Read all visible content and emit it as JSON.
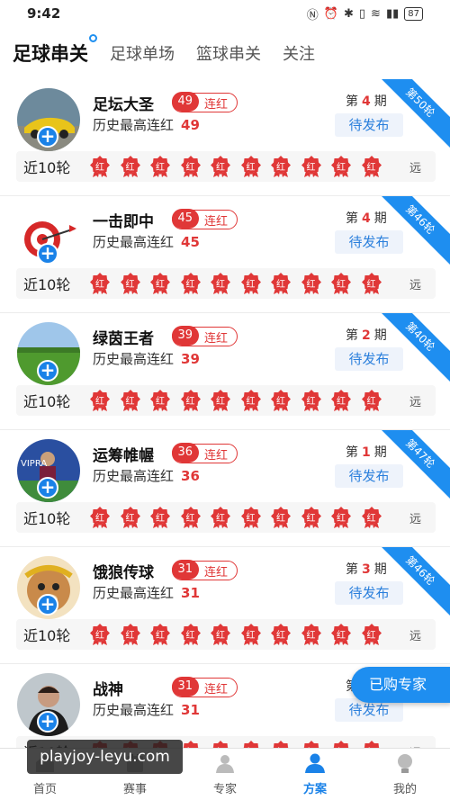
{
  "status_bar": {
    "time": "9:42",
    "battery": "87"
  },
  "tabs": [
    {
      "label": "足球串关",
      "active": true
    },
    {
      "label": "足球单场",
      "active": false
    },
    {
      "label": "篮球串关",
      "active": false
    },
    {
      "label": "关注",
      "active": false
    }
  ],
  "cards": [
    {
      "name": "足坛大圣",
      "streak": "49",
      "streak_label": "连红",
      "history_label": "历史最高连红",
      "history_value": "49",
      "period_prefix": "第",
      "period_num": "4",
      "period_suffix": "期",
      "publish": "待发布",
      "round": "第50轮",
      "recent_label": "近10轮",
      "recent": [
        "红",
        "红",
        "红",
        "红",
        "红",
        "红",
        "红",
        "红",
        "红",
        "红"
      ],
      "far": "远",
      "avatar": "car-avatar"
    },
    {
      "name": "一击即中",
      "streak": "45",
      "streak_label": "连红",
      "history_label": "历史最高连红",
      "history_value": "45",
      "period_prefix": "第",
      "period_num": "4",
      "period_suffix": "期",
      "publish": "待发布",
      "round": "第46轮",
      "recent_label": "近10轮",
      "recent": [
        "红",
        "红",
        "红",
        "红",
        "红",
        "红",
        "红",
        "红",
        "红",
        "红"
      ],
      "far": "远",
      "avatar": "dart-avatar"
    },
    {
      "name": "绿茵王者",
      "streak": "39",
      "streak_label": "连红",
      "history_label": "历史最高连红",
      "history_value": "39",
      "period_prefix": "第",
      "period_num": "2",
      "period_suffix": "期",
      "publish": "待发布",
      "round": "第40轮",
      "recent_label": "近10轮",
      "recent": [
        "红",
        "红",
        "红",
        "红",
        "红",
        "红",
        "红",
        "红",
        "红",
        "红"
      ],
      "far": "远",
      "avatar": "field-avatar"
    },
    {
      "name": "运筹帷幄",
      "streak": "36",
      "streak_label": "连红",
      "history_label": "历史最高连红",
      "history_value": "36",
      "period_prefix": "第",
      "period_num": "1",
      "period_suffix": "期",
      "publish": "待发布",
      "round": "第47轮",
      "recent_label": "近10轮",
      "recent": [
        "红",
        "红",
        "红",
        "红",
        "红",
        "红",
        "红",
        "红",
        "红",
        "红"
      ],
      "far": "远",
      "avatar": "player-avatar"
    },
    {
      "name": "饿狼传球",
      "streak": "31",
      "streak_label": "连红",
      "history_label": "历史最高连红",
      "history_value": "31",
      "period_prefix": "第",
      "period_num": "3",
      "period_suffix": "期",
      "publish": "待发布",
      "round": "第46轮",
      "recent_label": "近10轮",
      "recent": [
        "红",
        "红",
        "红",
        "红",
        "红",
        "红",
        "红",
        "红",
        "红",
        "红"
      ],
      "far": "远",
      "avatar": "monkey-avatar"
    },
    {
      "name": "战神",
      "streak": "31",
      "streak_label": "连红",
      "history_label": "历史最高连红",
      "history_value": "31",
      "period_prefix": "第",
      "period_num": "",
      "period_suffix": "",
      "publish": "待发布",
      "round": "",
      "recent_label": "近10轮",
      "recent": [
        "红",
        "红",
        "红",
        "红",
        "红",
        "红",
        "红",
        "红",
        "红",
        "红"
      ],
      "far": "远",
      "avatar": "man-avatar"
    }
  ],
  "float_button": "已购专家",
  "bottom_nav": [
    {
      "label": "首页",
      "icon": "home-icon",
      "active": false
    },
    {
      "label": "赛事",
      "icon": "match-icon",
      "active": false
    },
    {
      "label": "专家",
      "icon": "expert-icon",
      "active": false
    },
    {
      "label": "方案",
      "icon": "plan-icon",
      "active": true
    },
    {
      "label": "我的",
      "icon": "profile-icon",
      "active": false
    }
  ],
  "watermark": "playjoy-leyu.com",
  "colors": {
    "accent": "#1e8ef0",
    "red": "#e03737"
  }
}
